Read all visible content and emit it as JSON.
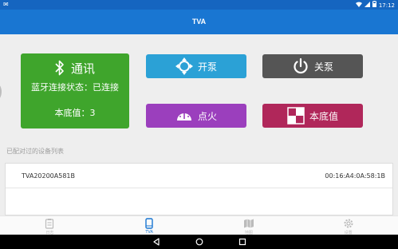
{
  "status_bar": {
    "left_icon": "mail-icon",
    "time": "17:12"
  },
  "app": {
    "title": "TVA"
  },
  "comm_card": {
    "icon": "bluetooth-icon",
    "title": "通讯",
    "status": "蓝牙连接状态：已连接",
    "base_value": "本底值：3"
  },
  "buttons": {
    "open_pump": {
      "label": "开泵",
      "icon": "crosshair-icon",
      "color": "#2ba1d6"
    },
    "close_pump": {
      "label": "关泵",
      "icon": "power-icon",
      "color": "#555555"
    },
    "ignite": {
      "label": "点火",
      "icon": "gauge-icon",
      "color": "#9b3fbd"
    },
    "base_value": {
      "label": "本底值",
      "icon": "checker-icon",
      "color": "#b0275a"
    }
  },
  "paired_list": {
    "title": "已配对过的设备列表",
    "devices": [
      {
        "name": "TVA20200A581B",
        "mac": "00:16:A4:0A:58:1B"
      }
    ]
  },
  "bottom_nav": [
    {
      "label": "日志",
      "icon": "clipboard-icon",
      "active": false
    },
    {
      "label": "TVA",
      "icon": "phone-icon",
      "active": true
    },
    {
      "label": "地图",
      "icon": "map-icon",
      "active": false
    },
    {
      "label": "设置",
      "icon": "gear-icon",
      "active": false
    }
  ],
  "colors": {
    "app_bar": "#1976d2",
    "status_bar": "#1565c0",
    "comm_card": "#3fa52c"
  }
}
